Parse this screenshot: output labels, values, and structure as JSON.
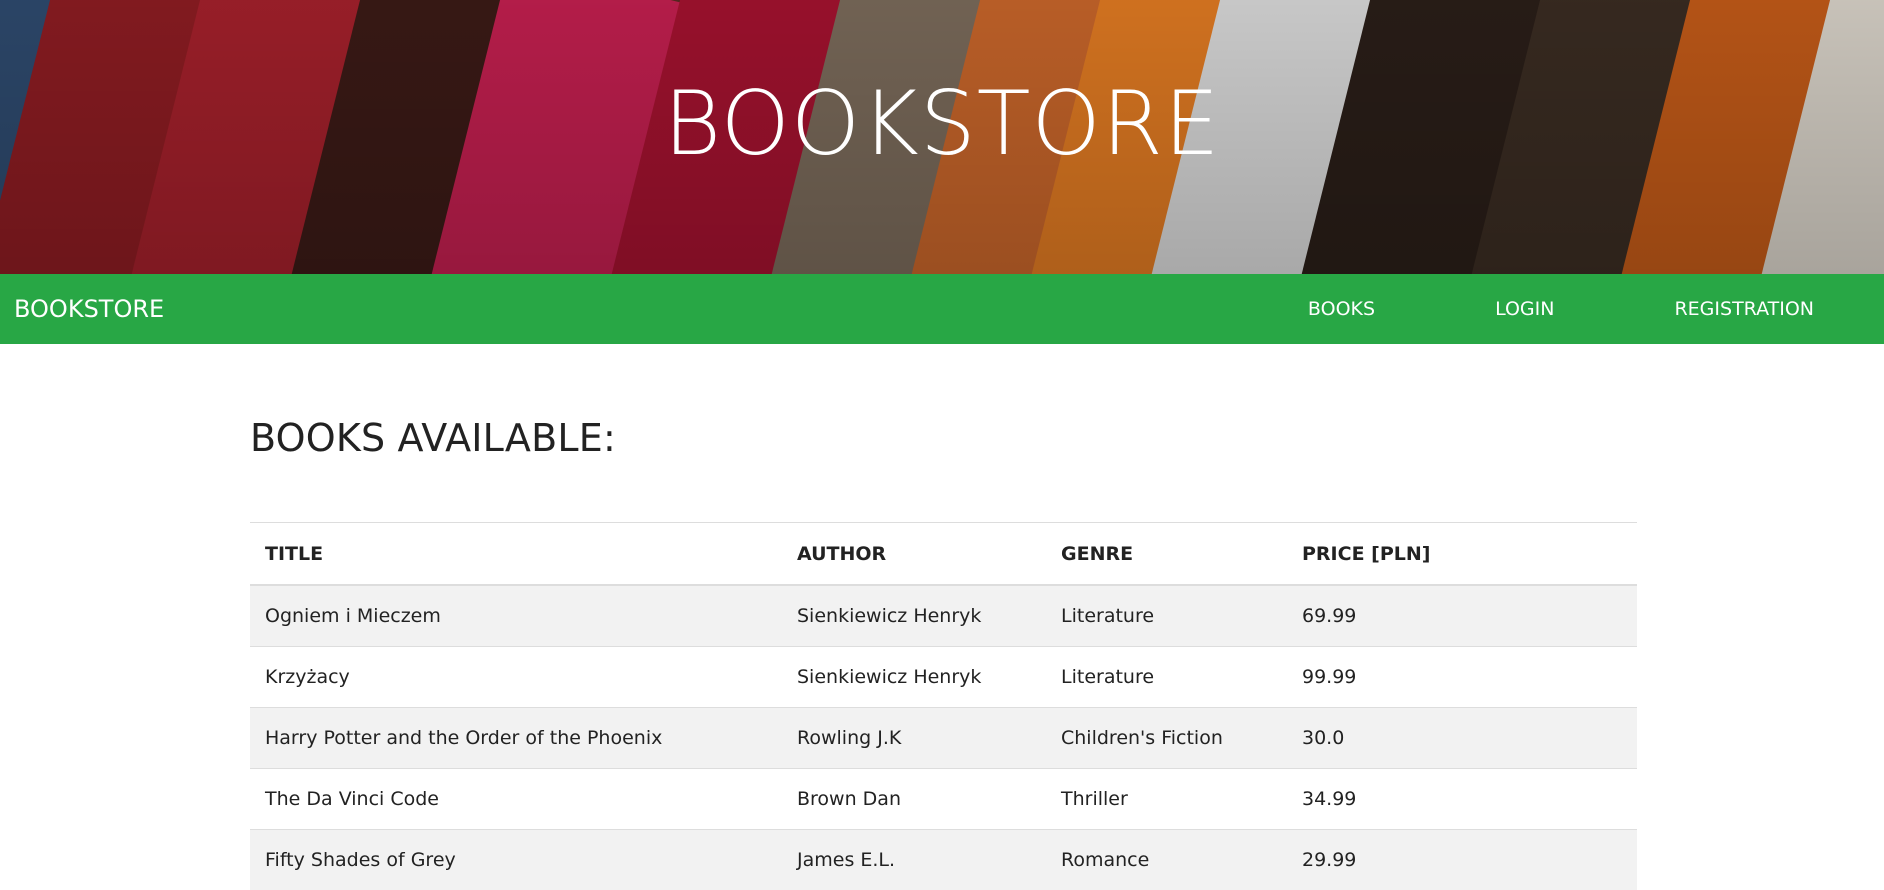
{
  "hero": {
    "title": "BOOKSTORE"
  },
  "navbar": {
    "brand": "BOOKSTORE",
    "links": [
      "BOOKS",
      "LOGIN",
      "REGISTRATION"
    ]
  },
  "main": {
    "heading": "BOOKS AVAILABLE:",
    "table": {
      "headers": [
        "TITLE",
        "AUTHOR",
        "GENRE",
        "PRICE [PLN]"
      ],
      "rows": [
        [
          "Ogniem i Mieczem",
          "Sienkiewicz Henryk",
          "Literature",
          "69.99"
        ],
        [
          "Krzyżacy",
          "Sienkiewicz Henryk",
          "Literature",
          "99.99"
        ],
        [
          "Harry Potter and the Order of the Phoenix",
          "Rowling J.K",
          "Children's Fiction",
          "30.0"
        ],
        [
          "The Da Vinci Code",
          "Brown Dan",
          "Thriller",
          "34.99"
        ],
        [
          "Fifty Shades of Grey",
          "James E.L.",
          "Romance",
          "29.99"
        ]
      ]
    }
  },
  "colors": {
    "navbar": "#28a745",
    "stripe": "#f2f2f2"
  }
}
